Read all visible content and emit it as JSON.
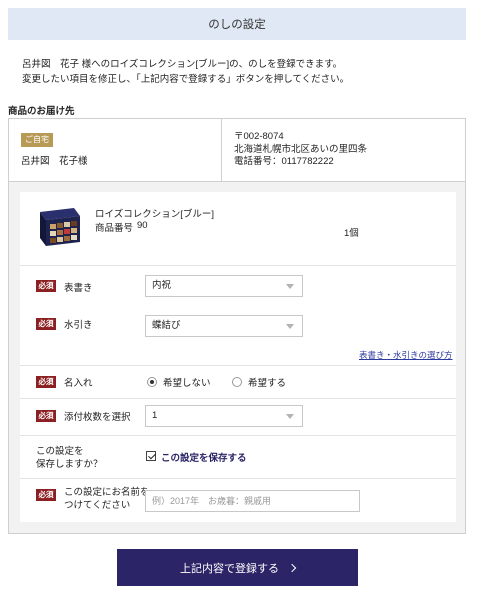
{
  "header": {
    "title": "のしの設定"
  },
  "intro": {
    "line1": "呂井図　花子 様へのロイズコレクション[ブルー]の、のしを登録できます。",
    "line2": "変更したい項目を修正し、「上記内容で登録する」ボタンを押してください。"
  },
  "delivery": {
    "section_title": "商品のお届け先",
    "badge": "ご自宅",
    "name": "呂井図　花子様",
    "postal": "〒002-8074",
    "address": "北海道札幌市北区あいの里四条",
    "phone": "電話番号：0117782222"
  },
  "product": {
    "name": "ロイズコレクション[ブルー]",
    "number_label": "商品番号",
    "number": "90",
    "quantity": "1個"
  },
  "form": {
    "required_label": "必須",
    "omotegaki": {
      "label": "表書き",
      "value": "内祝"
    },
    "mizuhiki": {
      "label": "水引き",
      "value": "蝶結び"
    },
    "help_link": "表書き・水引きの選び方",
    "naire": {
      "label": "名入れ",
      "option_no": "希望しない",
      "option_yes": "希望する",
      "selected": "希望しない"
    },
    "tenpu": {
      "label": "添付枚数を選択",
      "value": "1"
    },
    "save_setting": {
      "label_line1": "この設定を",
      "label_line2": "保存しますか？",
      "checkbox_label": "この設定を保存する",
      "checked": true
    },
    "setting_name": {
      "label_line1": "この設定にお名前を",
      "label_line2": "つけてください",
      "placeholder": "例）2017年　お歳暮：親戚用"
    }
  },
  "submit": {
    "label": "上記内容で登録する"
  },
  "colors": {
    "header_bg": "#dfe8f4",
    "required": "#8c1f22",
    "badge": "#b89a57",
    "submit_bg": "#2b2466",
    "link": "#2c3aa0"
  }
}
